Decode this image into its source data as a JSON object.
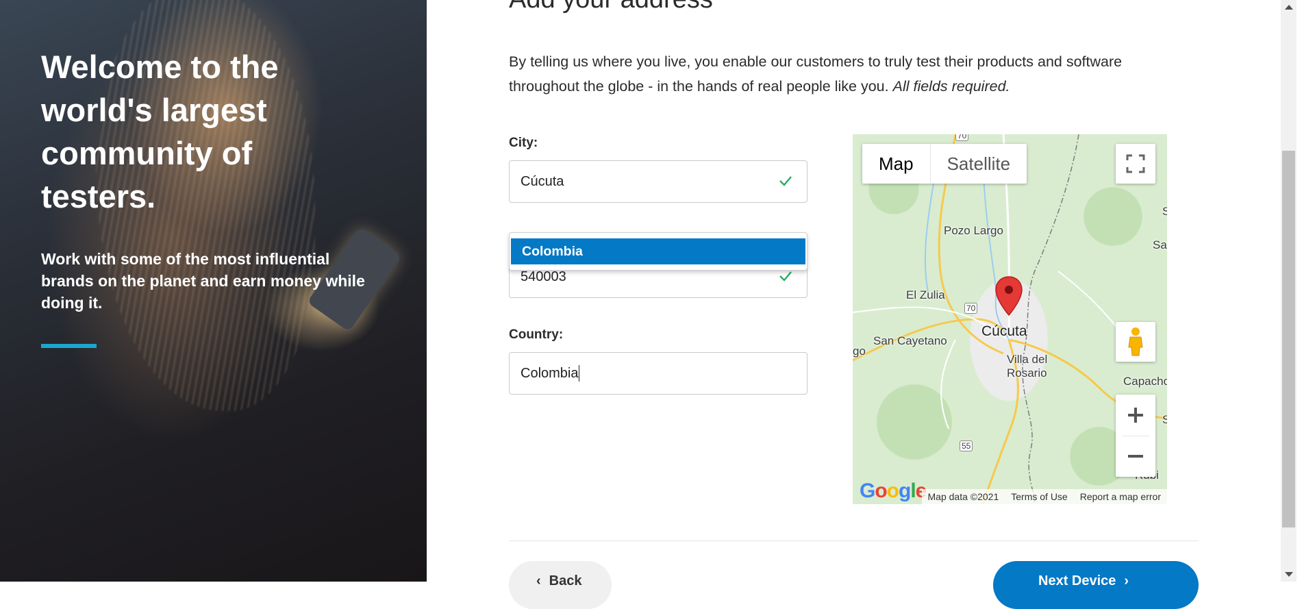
{
  "hero": {
    "title": "Welcome to the world's largest community of testers.",
    "subtitle": "Work with some of the most influential brands on the planet and earn money while doing it."
  },
  "page": {
    "heading": "Add your address",
    "intro": "By telling us where you live, you enable our customers to truly test their products and software throughout the globe - in the hands of real people like you.",
    "intro_note": "All fields required."
  },
  "form": {
    "city_label": "City:",
    "city_value": "Cúcuta",
    "postal_value": "540003",
    "country_label": "Country:",
    "country_value": "Colombia",
    "suggestion": "Colombia"
  },
  "map": {
    "type_map": "Map",
    "type_satellite": "Satellite",
    "labels": {
      "pozo_largo": "Pozo Largo",
      "el_zulia": "El Zulia",
      "san_cayetano": "San Cayetano",
      "cucuta": "Cúcuta",
      "villa_del_rosario_1": "Villa del",
      "villa_del_rosario_2": "Rosario",
      "capacho": "Capacho Vie",
      "rubio": "Rubi",
      "go": "go",
      "san": "San",
      "s1": "S",
      "s2": "S",
      "route_70a": "70",
      "route_70b": "70",
      "route_55": "55"
    },
    "footer_data": "Map data ©2021",
    "footer_terms": "Terms of Use",
    "footer_report": "Report a map error",
    "google_logo": "Google"
  },
  "buttons": {
    "back": "Back",
    "next": "Next Device"
  },
  "colors": {
    "accent_blue": "#0479c6",
    "hero_bar": "#1aa6cf",
    "check_green": "#27ae60",
    "pin_red": "#e53935"
  }
}
